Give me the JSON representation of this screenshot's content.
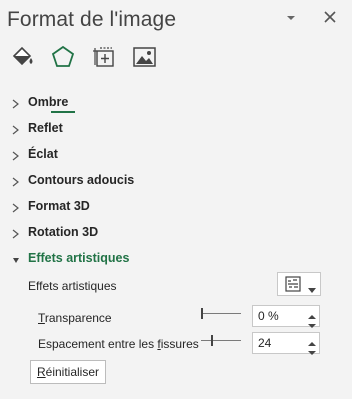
{
  "pane": {
    "title": "Format de l'image"
  },
  "header": {
    "dropdown_icon": "chevron-down-icon",
    "close_icon": "close-icon"
  },
  "tabs": [
    {
      "name": "fill-line",
      "icon": "paint-bucket-icon"
    },
    {
      "name": "effects",
      "icon": "pentagon-icon",
      "selected": true
    },
    {
      "name": "size-properties",
      "icon": "size-properties-icon"
    },
    {
      "name": "picture",
      "icon": "picture-icon"
    }
  ],
  "sections": [
    {
      "label": "Ombre",
      "expanded": false
    },
    {
      "label": "Reflet",
      "expanded": false
    },
    {
      "label": "Éclat",
      "expanded": false
    },
    {
      "label": "Contours adoucis",
      "expanded": false
    },
    {
      "label": "Format 3D",
      "expanded": false
    },
    {
      "label": "Rotation 3D",
      "expanded": false
    },
    {
      "label": "Effets artistiques",
      "expanded": true
    }
  ],
  "artistic": {
    "effect_label": "Effets artistiques",
    "transparency": {
      "label_ul": "T",
      "label_rest": "ransparence",
      "value": "0 %",
      "slider_fraction": 0.0
    },
    "crack_spacing": {
      "label_pre": "Espacement entre les ",
      "label_ul": "f",
      "label_rest": "issures",
      "value": "24",
      "slider_fraction": 0.24
    },
    "reset": {
      "label_ul": "R",
      "label_rest": "éinitialiser"
    }
  },
  "colors": {
    "accent": "#217346",
    "background": "#f3f3f3"
  }
}
